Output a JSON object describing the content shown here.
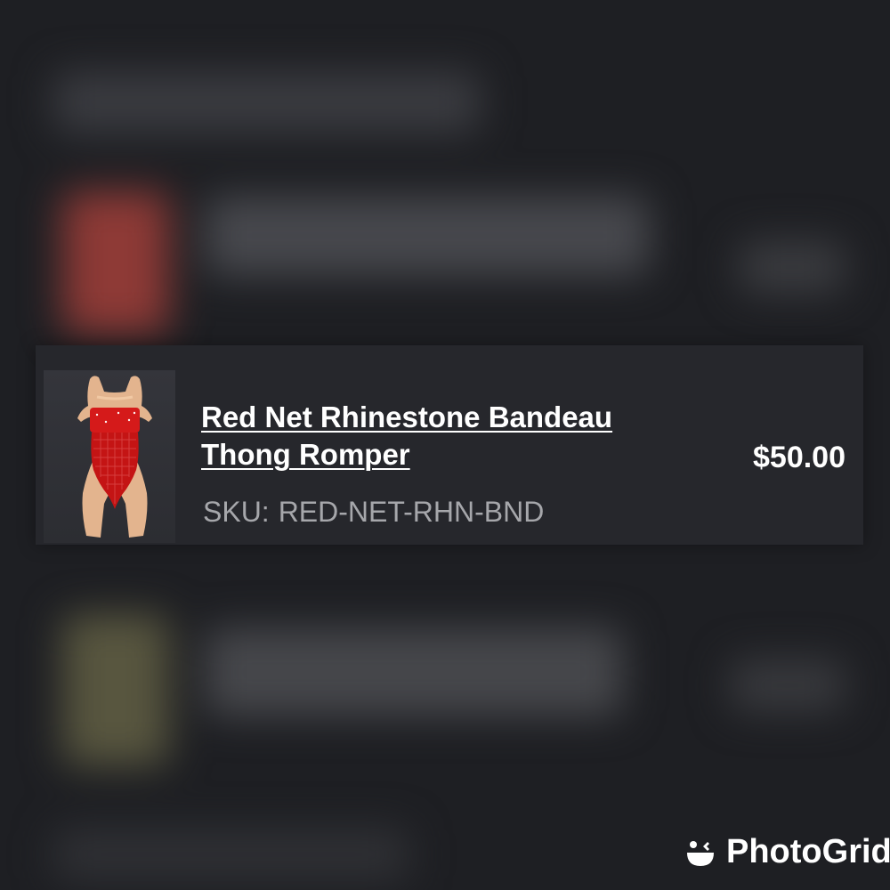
{
  "product": {
    "title": "Red Net Rhinestone Bandeau Thong Romper",
    "sku_label": "SKU:",
    "sku_value": "RED-NET-RHN-BND",
    "price": "$50.00",
    "thumbnail_icon": "product-photo"
  },
  "watermark": {
    "text": "PhotoGrid",
    "icon": "photogrid-logo-icon"
  },
  "colors": {
    "background": "#1e1f23",
    "row_background": "#26272c",
    "text_primary": "#ffffff",
    "text_secondary": "#a6a7ab",
    "product_red": "#d51a1a"
  }
}
